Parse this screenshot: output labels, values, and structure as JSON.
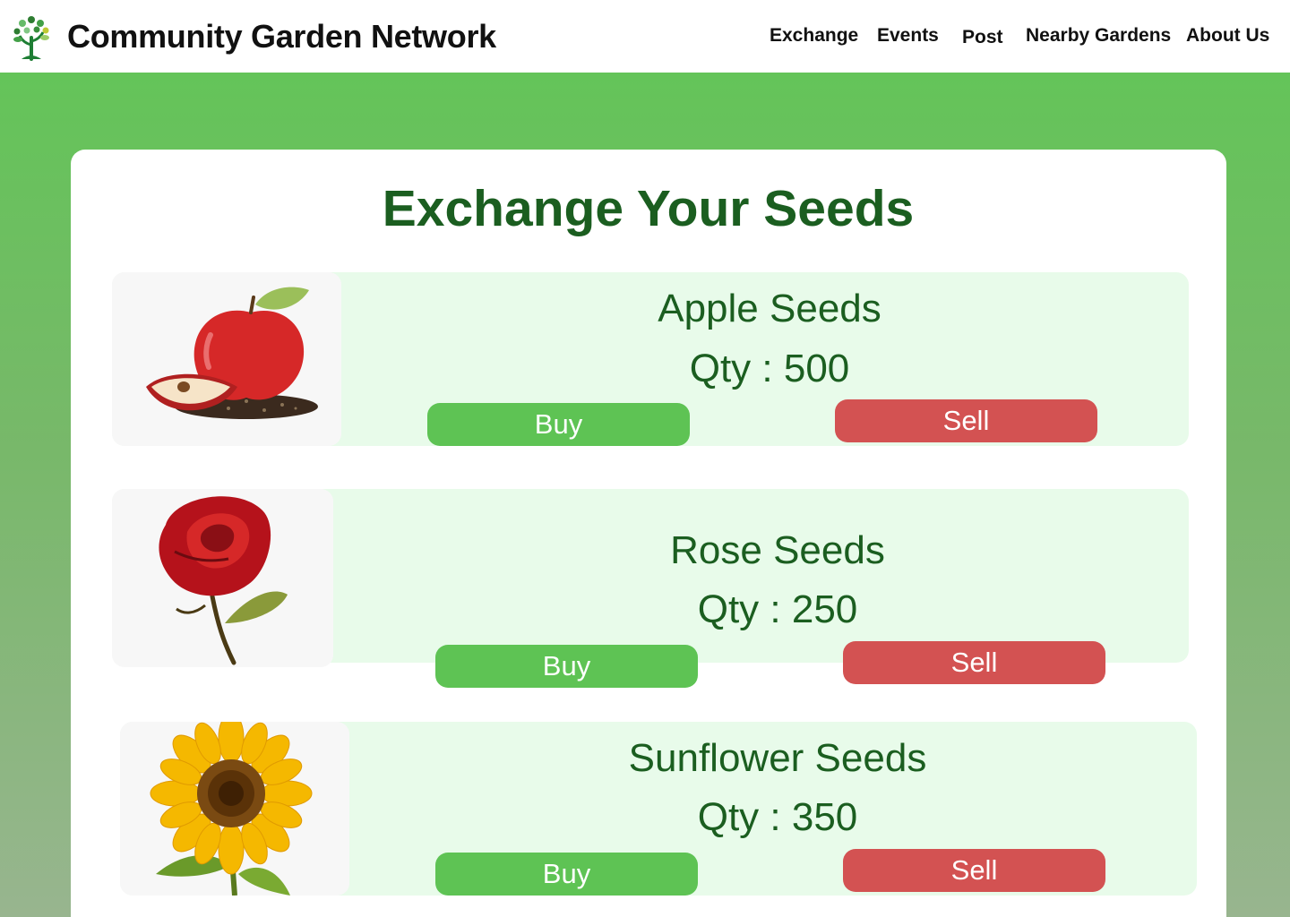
{
  "header": {
    "site_title": "Community Garden Network",
    "logo_icon": "tree-icon",
    "nav": [
      "Exchange",
      "Events",
      "Post",
      "Nearby Gardens",
      "About Us"
    ]
  },
  "main": {
    "title": "Exchange Your Seeds",
    "seeds": [
      {
        "name": "Apple Seeds",
        "qty": "Qty : 500",
        "image": "apple-image",
        "buy": "Buy",
        "sell": "Sell"
      },
      {
        "name": "Rose Seeds",
        "qty": "Qty : 250",
        "image": "rose-image",
        "buy": "Buy",
        "sell": "Sell"
      },
      {
        "name": "Sunflower Seeds",
        "qty": "Qty : 350",
        "image": "sunflower-image",
        "buy": "Buy",
        "sell": "Sell"
      }
    ]
  },
  "colors": {
    "accent_green": "#5ec354",
    "sell_red": "#d35252",
    "title_green": "#1b5e20",
    "card_bg": "#e8fbea"
  }
}
